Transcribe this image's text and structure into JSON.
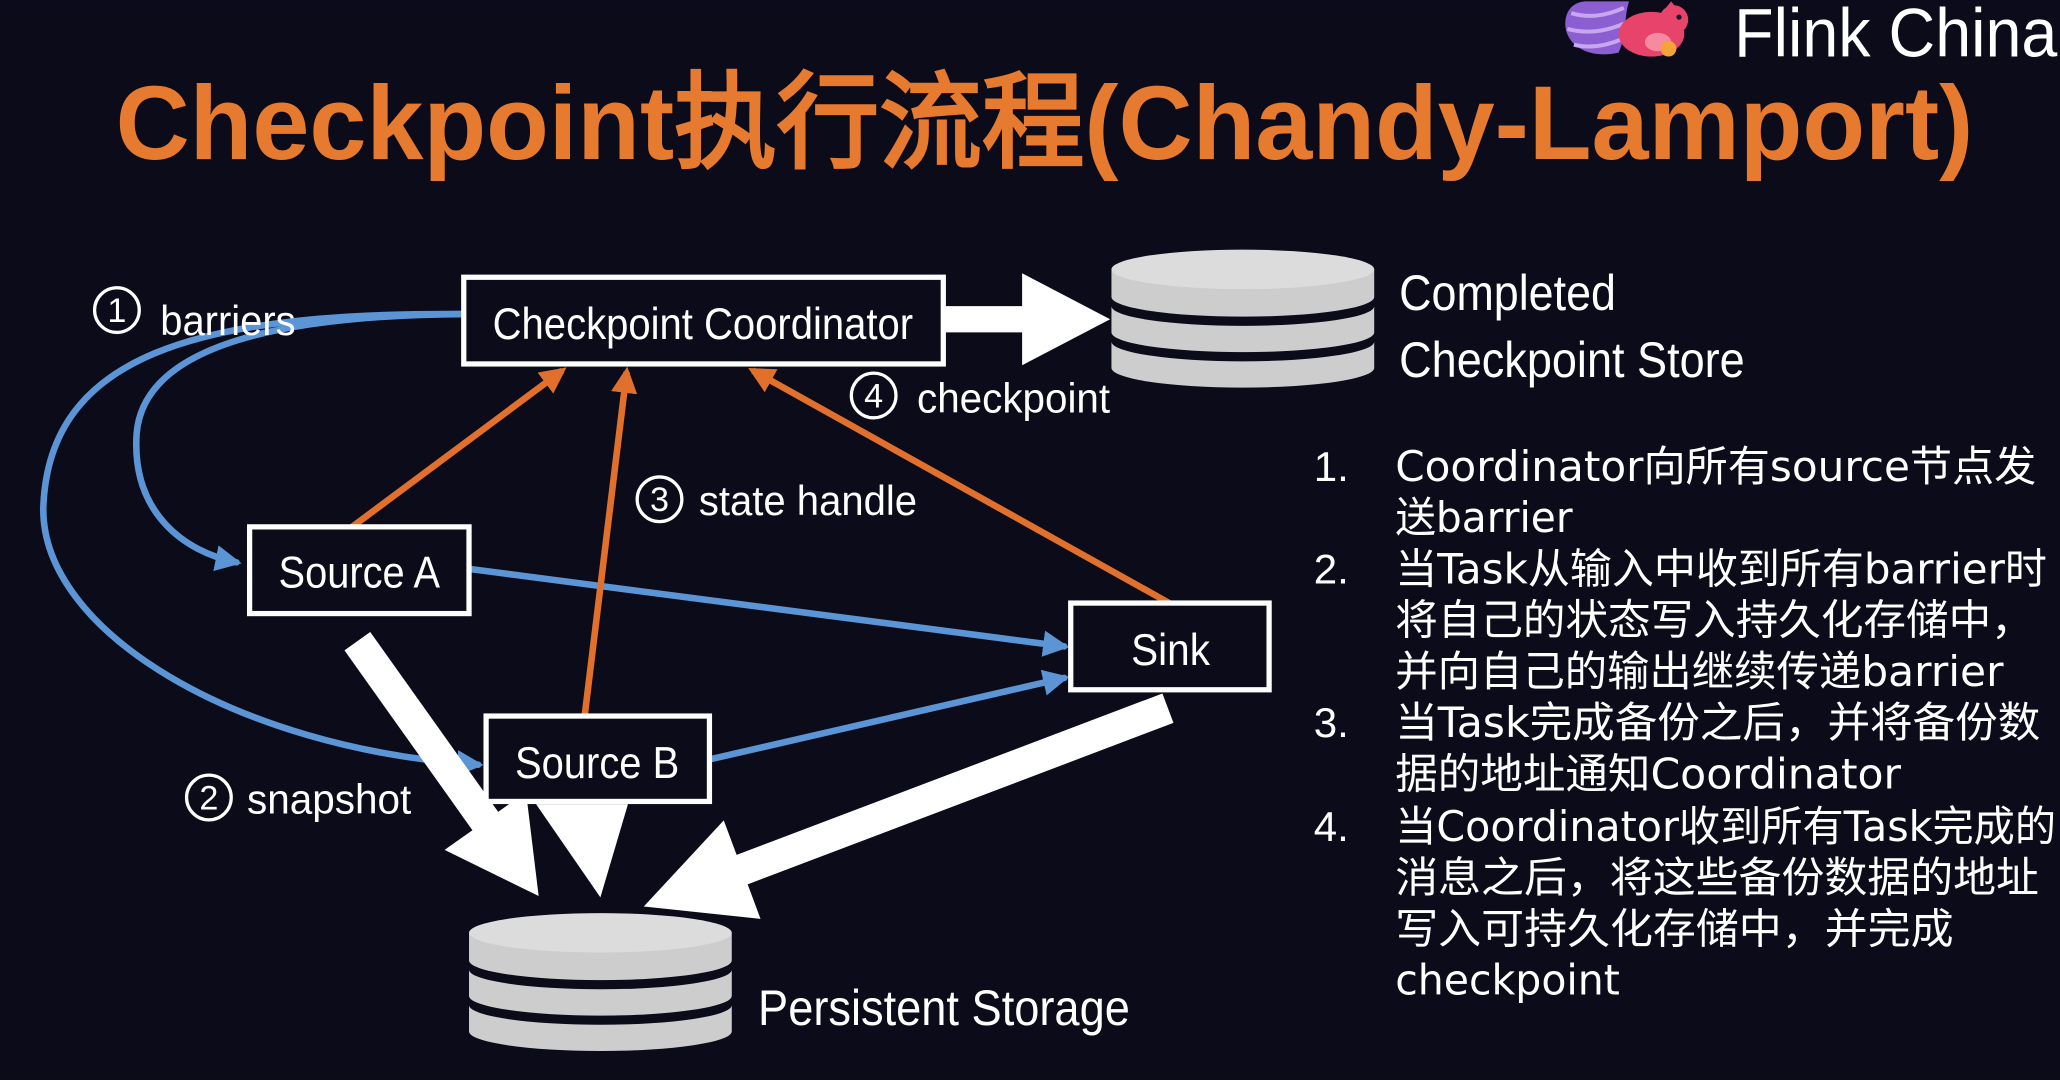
{
  "slide": {
    "brand_name": "Flink China",
    "title": "Checkpoint执行流程(Chandy-Lamport)"
  },
  "diagram": {
    "nodes": {
      "coordinator": "Checkpoint Coordinator",
      "source_a": "Source A",
      "source_b": "Source B",
      "sink": "Sink"
    },
    "stores": {
      "completed": [
        "Completed",
        "Checkpoint Store"
      ],
      "persistent": "Persistent Storage"
    },
    "steps": [
      {
        "number": "1",
        "label": "barriers"
      },
      {
        "number": "2",
        "label": "snapshot"
      },
      {
        "number": "3",
        "label": "state handle"
      },
      {
        "number": "4",
        "label": "checkpoint"
      }
    ]
  },
  "notes": [
    {
      "number": "1.",
      "lines": [
        "Coordinator向所有source节点发",
        "送barrier"
      ]
    },
    {
      "number": "2.",
      "lines": [
        "当Task从输入中收到所有barrier时",
        "将自己的状态写入持久化存储中，",
        "并向自己的输出继续传递barrier"
      ]
    },
    {
      "number": "3.",
      "lines": [
        "当Task完成备份之后，并将备份数",
        "据的地址通知Coordinator"
      ]
    },
    {
      "number": "4.",
      "lines": [
        "当Coordinator收到所有Task完成的",
        "消息之后，将这些备份数据的地址",
        "写入可持久化存储中，并完成",
        "checkpoint"
      ]
    }
  ],
  "icons": {
    "logo": "flink-squirrel",
    "storage": "database-cylinder"
  },
  "colors": {
    "background": "#0B0B1A",
    "title": "#E67A2E",
    "flow_blue": "#5B95D5",
    "flow_orange": "#E0702C",
    "storage_gray": "#CDCDCD",
    "text": "#FFFFFF"
  }
}
